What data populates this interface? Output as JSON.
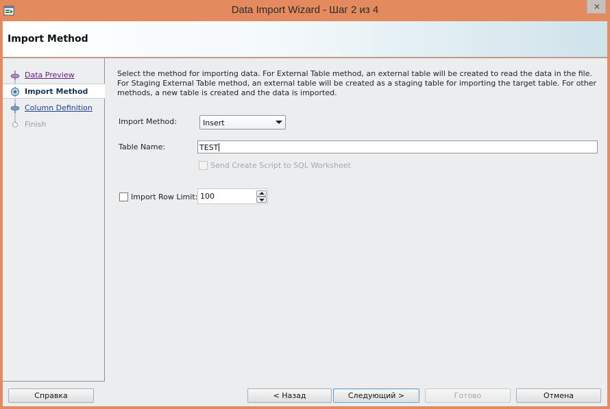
{
  "window": {
    "title": "Data Import Wizard - Шаг 2 из 4",
    "close_glyph": "✕"
  },
  "header": {
    "title": "Import Method"
  },
  "steps": [
    {
      "label": "Data Preview",
      "state": "visited"
    },
    {
      "label": "Import Method",
      "state": "current"
    },
    {
      "label": "Column Definition",
      "state": "link"
    },
    {
      "label": "Finish",
      "state": "disabled"
    }
  ],
  "main": {
    "description": "Select the method for importing data.  For External Table method, an external table will be created to read the data in the file.  For Staging External Table method, an external table will be created as a staging table for importing the target table.  For other methods, a new table is created and the data is imported.",
    "import_method": {
      "label": "Import Method:",
      "value": "Insert"
    },
    "table_name": {
      "label": "Table Name:",
      "value": "TEST"
    },
    "send_script": {
      "label": "Send Create Script to SQL Worksheet",
      "checked": false,
      "enabled": false
    },
    "row_limit": {
      "label": "Import Row Limit:",
      "checked": false,
      "value": "100"
    }
  },
  "buttons": {
    "help": "Справка",
    "back": "< Назад",
    "next": "Следующий >",
    "finish": "Готово",
    "cancel": "Отмена"
  },
  "icons": {
    "app": "data-import-wizard-icon",
    "close": "close-icon",
    "dropdown": "chevron-down-icon",
    "spin_up": "spin-up-icon",
    "spin_down": "spin-down-icon"
  },
  "colors": {
    "titlebar": "#e38a5f",
    "visited_link": "#6a1c86",
    "link": "#1b3f8d",
    "current_step": "#16335f"
  }
}
